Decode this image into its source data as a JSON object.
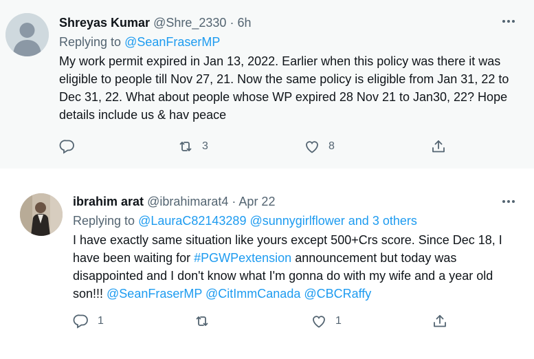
{
  "tweets": [
    {
      "name": "Shreyas Kumar",
      "handle": "@Shre_2330",
      "dot": "·",
      "time": "6h",
      "replying_prefix": "Replying to ",
      "replying_to": "@SeanFraserMP",
      "body": "My work permit expired in Jan 13, 2022. Earlier when this policy was there it was eligible to people till Nov 27, 21. Now the same policy is eligible from Jan 31, 22 to Dec 31, 22. What about people whose WP expired 28 Nov 21 to Jan30, 22? Hope details include us & hav peace",
      "reply_count": "",
      "retweet_count": "3",
      "like_count": "8"
    },
    {
      "name": "ibrahim arat",
      "handle": "@ibrahimarat4",
      "dot": "·",
      "time": "Apr 22",
      "replying_prefix": "Replying to ",
      "replying_to": "@LauraC82143289 @sunnygirlflower and 3 others",
      "body_part1": "I have exactly same situation like yours except 500+Crs score. Since Dec 18, I have been waiting for ",
      "hashtag": "#PGWPextension",
      "body_part2": " announcement but today was disappointed and I don't know what I'm gonna do with my wife and a year old son!!! ",
      "mentions": "@SeanFraserMP @CitImmCanada @CBCRaffy",
      "reply_count": "1",
      "retweet_count": "",
      "like_count": "1"
    }
  ],
  "icons": [
    "reply-icon",
    "retweet-icon",
    "like-icon",
    "share-icon",
    "more-icon"
  ],
  "colors": {
    "link": "#1d9bf0",
    "secondary": "#536471",
    "text": "#0f1419",
    "highlight_bg": "#f7f9f9"
  }
}
